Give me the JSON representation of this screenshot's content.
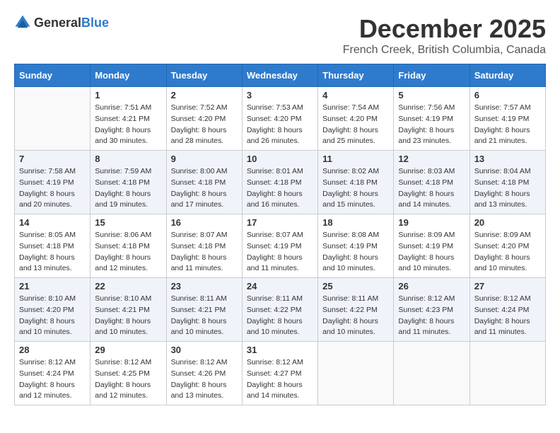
{
  "header": {
    "logo_general": "General",
    "logo_blue": "Blue",
    "month": "December 2025",
    "location": "French Creek, British Columbia, Canada"
  },
  "weekdays": [
    "Sunday",
    "Monday",
    "Tuesday",
    "Wednesday",
    "Thursday",
    "Friday",
    "Saturday"
  ],
  "weeks": [
    [
      {
        "day": "",
        "empty": true
      },
      {
        "day": "1",
        "sunrise": "Sunrise: 7:51 AM",
        "sunset": "Sunset: 4:21 PM",
        "daylight": "Daylight: 8 hours and 30 minutes."
      },
      {
        "day": "2",
        "sunrise": "Sunrise: 7:52 AM",
        "sunset": "Sunset: 4:20 PM",
        "daylight": "Daylight: 8 hours and 28 minutes."
      },
      {
        "day": "3",
        "sunrise": "Sunrise: 7:53 AM",
        "sunset": "Sunset: 4:20 PM",
        "daylight": "Daylight: 8 hours and 26 minutes."
      },
      {
        "day": "4",
        "sunrise": "Sunrise: 7:54 AM",
        "sunset": "Sunset: 4:20 PM",
        "daylight": "Daylight: 8 hours and 25 minutes."
      },
      {
        "day": "5",
        "sunrise": "Sunrise: 7:56 AM",
        "sunset": "Sunset: 4:19 PM",
        "daylight": "Daylight: 8 hours and 23 minutes."
      },
      {
        "day": "6",
        "sunrise": "Sunrise: 7:57 AM",
        "sunset": "Sunset: 4:19 PM",
        "daylight": "Daylight: 8 hours and 21 minutes."
      }
    ],
    [
      {
        "day": "7",
        "sunrise": "Sunrise: 7:58 AM",
        "sunset": "Sunset: 4:19 PM",
        "daylight": "Daylight: 8 hours and 20 minutes."
      },
      {
        "day": "8",
        "sunrise": "Sunrise: 7:59 AM",
        "sunset": "Sunset: 4:18 PM",
        "daylight": "Daylight: 8 hours and 19 minutes."
      },
      {
        "day": "9",
        "sunrise": "Sunrise: 8:00 AM",
        "sunset": "Sunset: 4:18 PM",
        "daylight": "Daylight: 8 hours and 17 minutes."
      },
      {
        "day": "10",
        "sunrise": "Sunrise: 8:01 AM",
        "sunset": "Sunset: 4:18 PM",
        "daylight": "Daylight: 8 hours and 16 minutes."
      },
      {
        "day": "11",
        "sunrise": "Sunrise: 8:02 AM",
        "sunset": "Sunset: 4:18 PM",
        "daylight": "Daylight: 8 hours and 15 minutes."
      },
      {
        "day": "12",
        "sunrise": "Sunrise: 8:03 AM",
        "sunset": "Sunset: 4:18 PM",
        "daylight": "Daylight: 8 hours and 14 minutes."
      },
      {
        "day": "13",
        "sunrise": "Sunrise: 8:04 AM",
        "sunset": "Sunset: 4:18 PM",
        "daylight": "Daylight: 8 hours and 13 minutes."
      }
    ],
    [
      {
        "day": "14",
        "sunrise": "Sunrise: 8:05 AM",
        "sunset": "Sunset: 4:18 PM",
        "daylight": "Daylight: 8 hours and 13 minutes."
      },
      {
        "day": "15",
        "sunrise": "Sunrise: 8:06 AM",
        "sunset": "Sunset: 4:18 PM",
        "daylight": "Daylight: 8 hours and 12 minutes."
      },
      {
        "day": "16",
        "sunrise": "Sunrise: 8:07 AM",
        "sunset": "Sunset: 4:18 PM",
        "daylight": "Daylight: 8 hours and 11 minutes."
      },
      {
        "day": "17",
        "sunrise": "Sunrise: 8:07 AM",
        "sunset": "Sunset: 4:19 PM",
        "daylight": "Daylight: 8 hours and 11 minutes."
      },
      {
        "day": "18",
        "sunrise": "Sunrise: 8:08 AM",
        "sunset": "Sunset: 4:19 PM",
        "daylight": "Daylight: 8 hours and 10 minutes."
      },
      {
        "day": "19",
        "sunrise": "Sunrise: 8:09 AM",
        "sunset": "Sunset: 4:19 PM",
        "daylight": "Daylight: 8 hours and 10 minutes."
      },
      {
        "day": "20",
        "sunrise": "Sunrise: 8:09 AM",
        "sunset": "Sunset: 4:20 PM",
        "daylight": "Daylight: 8 hours and 10 minutes."
      }
    ],
    [
      {
        "day": "21",
        "sunrise": "Sunrise: 8:10 AM",
        "sunset": "Sunset: 4:20 PM",
        "daylight": "Daylight: 8 hours and 10 minutes."
      },
      {
        "day": "22",
        "sunrise": "Sunrise: 8:10 AM",
        "sunset": "Sunset: 4:21 PM",
        "daylight": "Daylight: 8 hours and 10 minutes."
      },
      {
        "day": "23",
        "sunrise": "Sunrise: 8:11 AM",
        "sunset": "Sunset: 4:21 PM",
        "daylight": "Daylight: 8 hours and 10 minutes."
      },
      {
        "day": "24",
        "sunrise": "Sunrise: 8:11 AM",
        "sunset": "Sunset: 4:22 PM",
        "daylight": "Daylight: 8 hours and 10 minutes."
      },
      {
        "day": "25",
        "sunrise": "Sunrise: 8:11 AM",
        "sunset": "Sunset: 4:22 PM",
        "daylight": "Daylight: 8 hours and 10 minutes."
      },
      {
        "day": "26",
        "sunrise": "Sunrise: 8:12 AM",
        "sunset": "Sunset: 4:23 PM",
        "daylight": "Daylight: 8 hours and 11 minutes."
      },
      {
        "day": "27",
        "sunrise": "Sunrise: 8:12 AM",
        "sunset": "Sunset: 4:24 PM",
        "daylight": "Daylight: 8 hours and 11 minutes."
      }
    ],
    [
      {
        "day": "28",
        "sunrise": "Sunrise: 8:12 AM",
        "sunset": "Sunset: 4:24 PM",
        "daylight": "Daylight: 8 hours and 12 minutes."
      },
      {
        "day": "29",
        "sunrise": "Sunrise: 8:12 AM",
        "sunset": "Sunset: 4:25 PM",
        "daylight": "Daylight: 8 hours and 12 minutes."
      },
      {
        "day": "30",
        "sunrise": "Sunrise: 8:12 AM",
        "sunset": "Sunset: 4:26 PM",
        "daylight": "Daylight: 8 hours and 13 minutes."
      },
      {
        "day": "31",
        "sunrise": "Sunrise: 8:12 AM",
        "sunset": "Sunset: 4:27 PM",
        "daylight": "Daylight: 8 hours and 14 minutes."
      },
      {
        "day": "",
        "empty": true
      },
      {
        "day": "",
        "empty": true
      },
      {
        "day": "",
        "empty": true
      }
    ]
  ]
}
